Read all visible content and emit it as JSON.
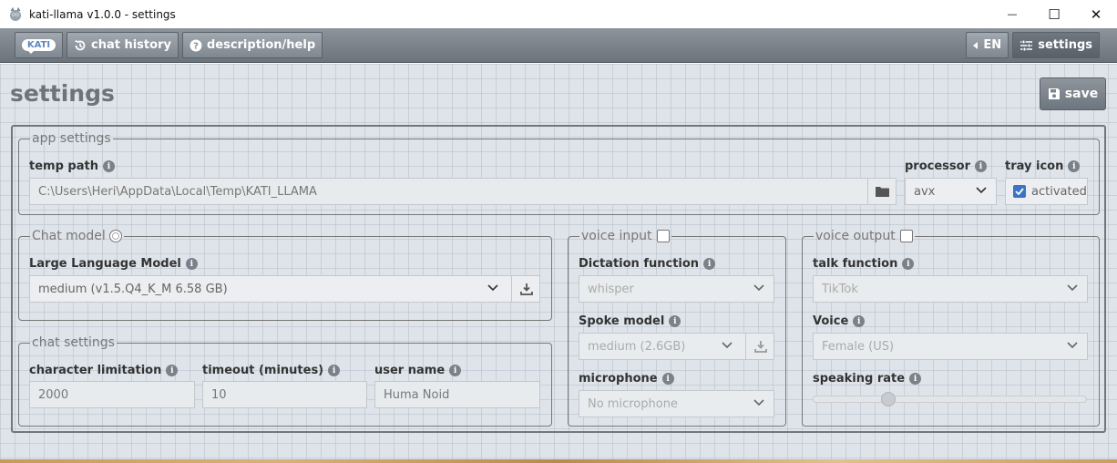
{
  "window": {
    "title": "kati-llama v1.0.0 - settings",
    "minimize_glyph": "—",
    "maximize_glyph": "☐",
    "close_glyph": "✕"
  },
  "nav": {
    "logo_text": "KATI",
    "chat_history_label": "chat history",
    "help_label": "description/help",
    "language_label": "EN",
    "settings_label": "settings"
  },
  "page": {
    "title": "settings",
    "save_label": "save"
  },
  "app_settings": {
    "legend": "app settings",
    "temp_path_label": "temp path",
    "temp_path_value": "C:\\Users\\Heri\\AppData\\Local\\Temp\\KATI_LLAMA",
    "processor_label": "processor",
    "processor_value": "avx",
    "tray_icon_label": "tray icon",
    "tray_icon_value": "activated",
    "tray_icon_checked": true
  },
  "chat_model": {
    "legend": "Chat model",
    "llm_label": "Large Language Model",
    "llm_value": "medium (v1.5.Q4_K_M 6.58 GB)"
  },
  "chat_settings": {
    "legend": "chat settings",
    "char_limit_label": "character limitation",
    "char_limit_value": "2000",
    "timeout_label": "timeout (minutes)",
    "timeout_value": "10",
    "user_name_label": "user name",
    "user_name_value": "Huma Noid"
  },
  "voice_input": {
    "legend": "voice input",
    "enabled": false,
    "dictation_label": "Dictation function",
    "dictation_value": "whisper",
    "spoke_model_label": "Spoke model",
    "spoke_model_value": "medium (2.6GB)",
    "microphone_label": "microphone",
    "microphone_value": "No microphone"
  },
  "voice_output": {
    "legend": "voice output",
    "enabled": false,
    "talk_label": "talk function",
    "talk_value": "TikTok",
    "voice_label": "Voice",
    "voice_value": "Female (US)",
    "rate_label": "speaking rate",
    "rate_fraction": 0.26
  },
  "icons": {
    "info": "info-icon",
    "folder": "folder-icon",
    "download": "download-icon",
    "chevron": "chevron-down-icon",
    "save": "floppy-disk-icon",
    "history": "history-icon",
    "help": "question-icon",
    "sliders": "sliders-icon"
  },
  "colors": {
    "accent": "#3d72c4",
    "toolbar": "#7d858e",
    "background": "#dfe4ea"
  }
}
